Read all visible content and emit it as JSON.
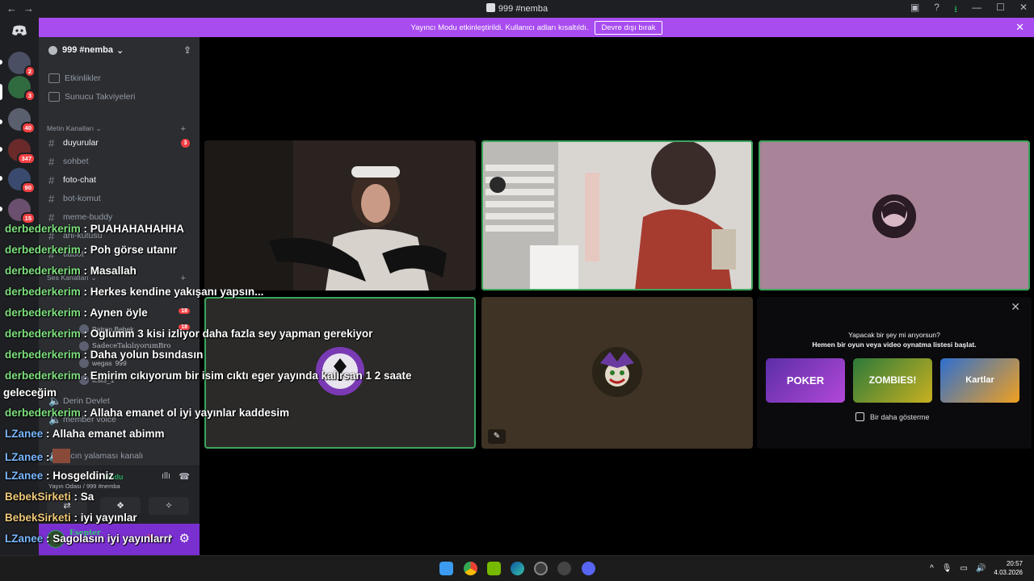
{
  "window": {
    "title": "999 #nemba",
    "nav_back": "←",
    "nav_forward": "→",
    "btn_inbox": "▣",
    "btn_help": "?",
    "btn_download": "⭳",
    "btn_min": "—",
    "btn_max": "☐",
    "btn_close": "✕"
  },
  "notice": {
    "text": "Yayıncı Modu etkinleştirildi. Kullanıcı adları kısaltıldı.",
    "button": "Devre dışı bırak",
    "close": "✕"
  },
  "guilds": {
    "discord_icon": "discord-icon",
    "badges": [
      "2",
      "3",
      "40",
      "347",
      "90",
      "15"
    ]
  },
  "server": {
    "name": "999 #nemba",
    "chevron": "⌄",
    "invite_icon": "⇪"
  },
  "sidebar": {
    "top_items": [
      {
        "label": "Etkinlikler"
      },
      {
        "label": "Sunucu Takviyeleri"
      }
    ],
    "text_category": "Metin Kanalları",
    "text_channels": [
      {
        "label": "duyurular",
        "badge": "3"
      },
      {
        "label": "sohbet"
      },
      {
        "label": "foto-chat"
      },
      {
        "label": "bot-komut"
      },
      {
        "label": "meme-buddy"
      },
      {
        "label": "ani-kutusu"
      },
      {
        "label": "tlabot"
      }
    ],
    "voice_category": "Ses Kanalları",
    "voice_users": [
      {
        "name": "Patron Bebek",
        "badge": "18"
      },
      {
        "name": "SadeceTakılıyorumBro"
      },
      {
        "name": "wegas",
        "tag": "999"
      },
      {
        "name": "tcst3_1"
      }
    ],
    "voice_channels": [
      {
        "label": "Derin Devlet"
      },
      {
        "label": "member voice"
      },
      {
        "label": "racın yalaması kanalı"
      }
    ],
    "voice_panel": {
      "status": "Ses Bağlandı",
      "status_suffix": "ruldu",
      "channel": "Yayın Odası / 999 #nemba",
      "btn1": "⇄",
      "btn2": "❖",
      "btn3": "✧"
    },
    "user": {
      "name": "Esepter",
      "settings": "⚙",
      "mic": "🎙",
      "headphone": "⌂"
    }
  },
  "activity_card": {
    "close": "✕",
    "line1": "Yapacak bir şey mi arıyorsun?",
    "line2": "Hemen bir oyun veya video oynatma listesi başlat.",
    "games": [
      {
        "label": "POKER"
      },
      {
        "label": "ZOMBIES!"
      },
      {
        "label": "Kartlar"
      }
    ],
    "dont_show": "Bir daha gösterme"
  },
  "chat_overlay": [
    {
      "user": "derbederkerim",
      "text": " : PUAHAHAHAHHA",
      "color": "u1"
    },
    {
      "user": "derbederkerim",
      "text": " : Poh görse utanır",
      "color": "u1"
    },
    {
      "user": "derbederkerim",
      "text": " : Masallah",
      "color": "u1"
    },
    {
      "user": "derbederkerim",
      "text": " : Herkes kendine yakışanı yapsın...",
      "color": "u1"
    },
    {
      "user": "derbederkerim",
      "text": " : Aynen öyle",
      "color": "u1"
    },
    {
      "user": "derbederkerim",
      "text": " : Oglumm 3 kisi izliyor daha fazla sey yapman gerekiyor",
      "color": "u1"
    },
    {
      "user": "derbederkerim",
      "text": " : Daha yolun bsındasın",
      "color": "u1"
    },
    {
      "user": "derbederkerim",
      "text": " : Emirim cıkıyorum bir isim cıktı eger yayında kalırsan 1 2 saate",
      "color": "u1"
    },
    {
      "user": "",
      "text": "geleceğim",
      "color": "u1"
    },
    {
      "user": "derbederkerim",
      "text": " : Allaha emanet ol iyi yayınlar kaddesim",
      "color": "u1"
    },
    {
      "user": "LZanee",
      "text": " : Allaha emanet abimm",
      "color": "u2"
    },
    {
      "user": "LZanee",
      "text": " : ",
      "color": "u2"
    },
    {
      "user": "LZanee",
      "text": " : Hosgeldiniz",
      "color": "u2"
    },
    {
      "user": "BebekSirketi",
      "text": " : Sa",
      "color": "u3"
    },
    {
      "user": "BebekSirketi",
      "text": " : iyi yayınlar",
      "color": "u3"
    },
    {
      "user": "LZanee",
      "text": " : Sagolasın iyi yayınlarrr",
      "color": "u2"
    }
  ],
  "tray": {
    "time": "20:57",
    "date": "4.03.2026",
    "chevron": "^"
  }
}
